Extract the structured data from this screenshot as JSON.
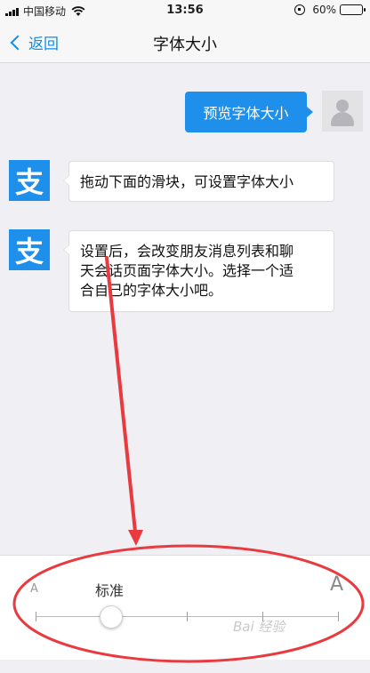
{
  "status_bar": {
    "carrier": "中国移动",
    "time": "13:56",
    "battery": "60%",
    "battery_level": 0.6
  },
  "nav": {
    "back_label": "返回",
    "title": "字体大小"
  },
  "chat": {
    "preview_bubble": "预览字体大小",
    "ali_avatar_glyph": "支",
    "message1": "拖动下面的滑块，可设置字体大小",
    "message2_lines": [
      "设置后，会改变朋友消息列表和聊",
      "天会话页面字体大小。选择一个适",
      "合自己的字体大小吧。"
    ]
  },
  "slider": {
    "small_label": "A",
    "large_label": "A",
    "current_label": "标准",
    "steps": 5,
    "selected_index": 1
  },
  "watermark": "Bai 经验",
  "colors": {
    "accent": "#1f8fec",
    "annotation": "#e83a3f"
  }
}
